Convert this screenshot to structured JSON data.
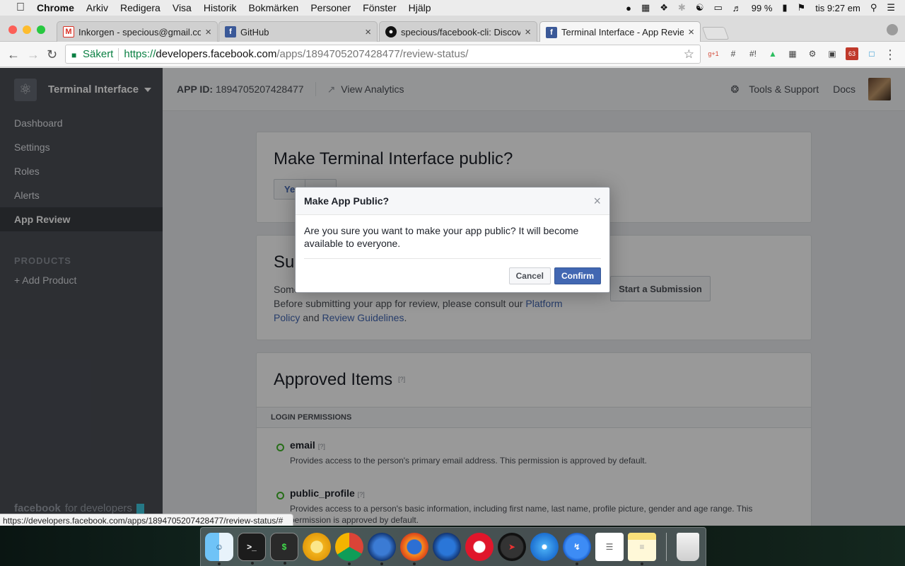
{
  "menubar": {
    "app": "Chrome",
    "items": [
      "Arkiv",
      "Redigera",
      "Visa",
      "Historik",
      "Bokmärken",
      "Personer",
      "Fönster",
      "Hjälp"
    ],
    "battery": "99 %",
    "clock": "tis 9:27 em"
  },
  "tabs": [
    {
      "label": "Inkorgen - specious@gmail.co",
      "icon": "gmail-icon",
      "color": "#d93025"
    },
    {
      "label": "GitHub",
      "icon": "facebook-icon",
      "color": "#3b5998"
    },
    {
      "label": "specious/facebook-cli: Discove",
      "icon": "github-icon",
      "color": "#111111"
    },
    {
      "label": "Terminal Interface - App Revie",
      "icon": "facebook-icon",
      "color": "#3b5998"
    }
  ],
  "omnibox": {
    "secure_label": "Säkert",
    "scheme": "https://",
    "host": "developers.facebook.com",
    "path": "/apps/1894705207428477/review-status/"
  },
  "sidebar": {
    "app_name": "Terminal Interface",
    "items": [
      {
        "label": "Dashboard"
      },
      {
        "label": "Settings"
      },
      {
        "label": "Roles"
      },
      {
        "label": "Alerts"
      },
      {
        "label": "App Review",
        "active": true
      }
    ],
    "section": "PRODUCTS",
    "add_product": "+ Add Product",
    "brand": "facebook",
    "brand_suffix": "for developers"
  },
  "topbar": {
    "app_id_label": "APP ID:",
    "app_id": "1894705207428477",
    "analytics": "View Analytics",
    "tools": "Tools & Support",
    "docs": "Docs"
  },
  "public_card": {
    "title": "Make Terminal Interface public?",
    "yes_fragment": "Ye"
  },
  "submission_card": {
    "title_fragment": "Sub",
    "text_fragment": "Some",
    "text_line2": "Before submitting your app for review, please consult our",
    "link1_a": "Platform",
    "link1_b": "Policy",
    "and": "and",
    "link2": "Review Guidelines",
    "period": ".",
    "button": "Start a Submission"
  },
  "approved": {
    "title": "Approved Items",
    "q": "[?]",
    "section": "LOGIN PERMISSIONS",
    "permissions": [
      {
        "name": "email",
        "q": "[?]",
        "desc": "Provides access to the person's primary email address. This permission is approved by default."
      },
      {
        "name": "public_profile",
        "q": "[?]",
        "desc": "Provides access to a person's basic information, including first name, last name, profile picture, gender and age range. This permission is approved by default."
      }
    ]
  },
  "dialog": {
    "title": "Make App Public?",
    "body": "Are you sure you want to make your app public? It will become available to everyone.",
    "cancel": "Cancel",
    "confirm": "Confirm"
  },
  "statusbar": "https://developers.facebook.com/apps/1894705207428477/review-status/#",
  "ext_badge": "63",
  "dock": [
    "Finder",
    "Terminal",
    "Terminal",
    "Chrome Canary",
    "Chrome",
    "Firefox Nightly",
    "Firefox",
    "Firefox Developer",
    "Opera",
    "Compass",
    "Safari",
    "Messenger",
    "Reminders",
    "Notes",
    "Trash"
  ]
}
